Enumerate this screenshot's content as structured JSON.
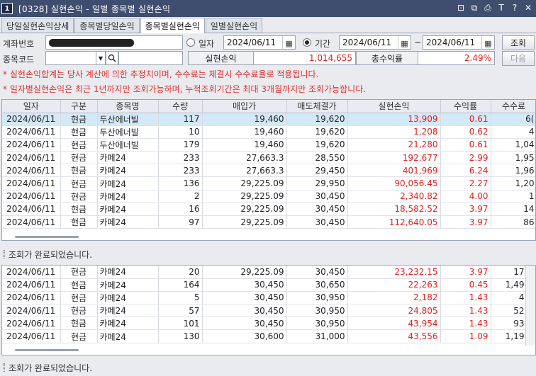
{
  "window": {
    "number": "1",
    "title": "[0328] 실현손익 - 일별 종목별 실현손익",
    "tools": [
      "⊡",
      "⧉",
      "⎙",
      "T",
      "?",
      "✕"
    ]
  },
  "tabs": [
    {
      "label": "당일실현손익상세",
      "active": false
    },
    {
      "label": "종목별당일손익",
      "active": false
    },
    {
      "label": "종목별실현손익",
      "active": true
    },
    {
      "label": "일별실현손익",
      "active": false
    }
  ],
  "form": {
    "account_label": "계좌번호",
    "account_value": "",
    "mode_date_label": "일자",
    "mode_period_label": "기간",
    "date_single": "2024/06/11",
    "period_from": "2024/06/11",
    "period_sep": "~",
    "period_to": "2024/06/11",
    "query_button": "조회",
    "stock_code_label": "종목코드",
    "stock_code_value": "",
    "realized_label": "실현손익",
    "realized_value": "1,014,655",
    "total_return_label": "총수익률",
    "total_return_value": "2.49%",
    "next_button": "다음"
  },
  "notices": [
    "* 실현손익합계는 당사 계산에 의한 추정치이며, 수수료는 체결시 수수료율로 적용됩니다.",
    "* 일자별실현손익은 최근 1년까지만 조회가능하며, 누적조회기간은 최대 3개월까지만 조회가능합니다."
  ],
  "table": {
    "columns": [
      "일자",
      "구분",
      "종목명",
      "수량",
      "매입가",
      "매도체결가",
      "실현손익",
      "수익률",
      "수수료"
    ],
    "rows_top": [
      [
        "2024/06/11",
        "현금",
        "두산에너빌",
        "117",
        "19,460",
        "19,620",
        "13,909",
        "0.61",
        "6("
      ],
      [
        "2024/06/11",
        "현금",
        "두산에너빌",
        "10",
        "19,460",
        "19,620",
        "1,208",
        "0.62",
        "4"
      ],
      [
        "2024/06/11",
        "현금",
        "두산에너빌",
        "179",
        "19,460",
        "19,620",
        "21,280",
        "0.61",
        "1,04"
      ],
      [
        "2024/06/11",
        "현금",
        "카페24",
        "233",
        "27,663.3",
        "28,550",
        "192,677",
        "2.99",
        "1,95"
      ],
      [
        "2024/06/11",
        "현금",
        "카페24",
        "233",
        "27,663.3",
        "29,450",
        "401,969",
        "6.24",
        "1,96"
      ],
      [
        "2024/06/11",
        "현금",
        "카페24",
        "136",
        "29,225.09",
        "29,950",
        "90,056.45",
        "2.27",
        "1,20"
      ],
      [
        "2024/06/11",
        "현금",
        "카페24",
        "2",
        "29,225.09",
        "30,450",
        "2,340.82",
        "4.00",
        "1"
      ],
      [
        "2024/06/11",
        "현금",
        "카페24",
        "16",
        "29,225.09",
        "30,450",
        "18,582.52",
        "3.97",
        "14"
      ],
      [
        "2024/06/11",
        "현금",
        "카페24",
        "97",
        "29,225.09",
        "30,450",
        "112,640.05",
        "3.97",
        "86"
      ]
    ],
    "rows_bottom": [
      [
        "2024/06/11",
        "현금",
        "카페24",
        "20",
        "29,225.09",
        "30,450",
        "23,232.15",
        "3.97",
        "17"
      ],
      [
        "2024/06/11",
        "현금",
        "카페24",
        "164",
        "30,450",
        "30,650",
        "22,263",
        "0.45",
        "1,49"
      ],
      [
        "2024/06/11",
        "현금",
        "카페24",
        "5",
        "30,450",
        "30,950",
        "2,182",
        "1.43",
        "4"
      ],
      [
        "2024/06/11",
        "현금",
        "카페24",
        "57",
        "30,450",
        "30,950",
        "24,805",
        "1.43",
        "52"
      ],
      [
        "2024/06/11",
        "현금",
        "카페24",
        "101",
        "30,450",
        "30,950",
        "43,954",
        "1.43",
        "93"
      ],
      [
        "2024/06/11",
        "현금",
        "카페24",
        "130",
        "30,600",
        "31,000",
        "43,556",
        "1.09",
        "1,19"
      ]
    ]
  },
  "status_top": "조회가 완료되었습니다.",
  "status_bottom": "조회가 완료되었습니다.",
  "colors": {
    "title_bar": "#3f4d6e",
    "notice": "#e03030",
    "profit": "#e02020",
    "selected_row": "#d4e9f7"
  }
}
